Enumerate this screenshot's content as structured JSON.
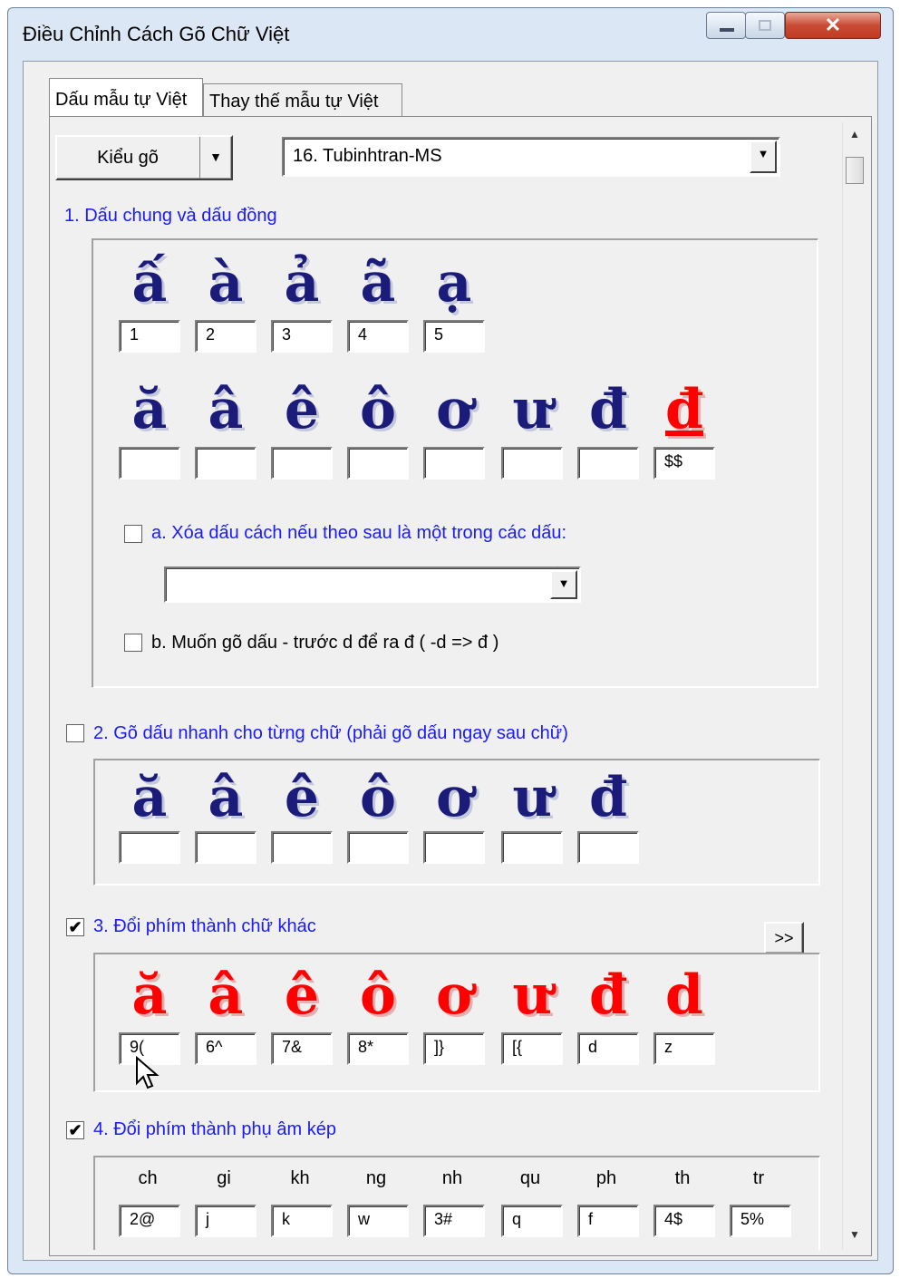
{
  "window": {
    "title": "Điều Chỉnh Cách Gõ Chữ Việt"
  },
  "tabs": [
    {
      "label": "Dấu mẫu tự Việt",
      "active": true
    },
    {
      "label": "Thay thế mẫu tự Việt",
      "active": false
    }
  ],
  "toolbar": {
    "kieugo_label": "Kiểu gõ",
    "scheme_value": "16. Tubinhtran-MS"
  },
  "section1": {
    "title": "1. Dấu chung và dấu đồng",
    "tones": [
      {
        "glyph": "ấ",
        "value": "1"
      },
      {
        "glyph": "à",
        "value": "2"
      },
      {
        "glyph": "ả",
        "value": "3"
      },
      {
        "glyph": "ã",
        "value": "4"
      },
      {
        "glyph": "ạ",
        "value": "5"
      }
    ],
    "letters": [
      {
        "glyph": "ă",
        "value": ""
      },
      {
        "glyph": "â",
        "value": ""
      },
      {
        "glyph": "ê",
        "value": ""
      },
      {
        "glyph": "ô",
        "value": ""
      },
      {
        "glyph": "ơ",
        "value": ""
      },
      {
        "glyph": "ư",
        "value": ""
      },
      {
        "glyph": "đ",
        "value": ""
      },
      {
        "glyph": "đ",
        "value": "$$"
      }
    ],
    "option_a": {
      "label": "a. Xóa dấu cách nếu theo sau là một trong các dấu:",
      "checked": false,
      "select_value": ""
    },
    "option_b": {
      "label": "b. Muốn gõ dấu - trước d để ra đ ( -d => đ )",
      "checked": false
    }
  },
  "section2": {
    "title": "2. Gõ dấu nhanh cho từng chữ (phải gõ dấu ngay sau chữ)",
    "checked": false,
    "letters": [
      {
        "glyph": "ă",
        "value": ""
      },
      {
        "glyph": "â",
        "value": ""
      },
      {
        "glyph": "ê",
        "value": ""
      },
      {
        "glyph": "ô",
        "value": ""
      },
      {
        "glyph": "ơ",
        "value": ""
      },
      {
        "glyph": "ư",
        "value": ""
      },
      {
        "glyph": "đ",
        "value": ""
      }
    ],
    "more_label": ">>"
  },
  "section3": {
    "title": "3. Đổi phím thành chữ khác",
    "checked": true,
    "letters": [
      {
        "glyph": "ă",
        "value": "9("
      },
      {
        "glyph": "â",
        "value": "6^"
      },
      {
        "glyph": "ê",
        "value": "7&"
      },
      {
        "glyph": "ô",
        "value": "8*"
      },
      {
        "glyph": "ơ",
        "value": "]}"
      },
      {
        "glyph": "ư",
        "value": "[{"
      },
      {
        "glyph": "đ",
        "value": "d"
      },
      {
        "glyph": "d",
        "value": "z"
      }
    ]
  },
  "section4": {
    "title": "4. Đổi phím thành phụ âm kép",
    "checked": true,
    "columns": [
      {
        "label": "ch",
        "value": "2@"
      },
      {
        "label": "gi",
        "value": "j"
      },
      {
        "label": "kh",
        "value": "k"
      },
      {
        "label": "ng",
        "value": "w"
      },
      {
        "label": "nh",
        "value": "3#"
      },
      {
        "label": "qu",
        "value": "q"
      },
      {
        "label": "ph",
        "value": "f"
      },
      {
        "label": "th",
        "value": "4$"
      },
      {
        "label": "tr",
        "value": "5%"
      }
    ]
  },
  "colors": {
    "title_blue": "#1a1aff",
    "glyph_navy": "#1b1b7a",
    "glyph_red": "#ff0000"
  },
  "icons": {
    "minimize": "minimize-icon",
    "maximize": "maximize-icon",
    "close": "close-icon",
    "dropdown": "chevron-down-icon",
    "scroll_up": "scroll-up-icon",
    "scroll_down": "scroll-down-icon",
    "cursor": "mouse-pointer-icon"
  }
}
